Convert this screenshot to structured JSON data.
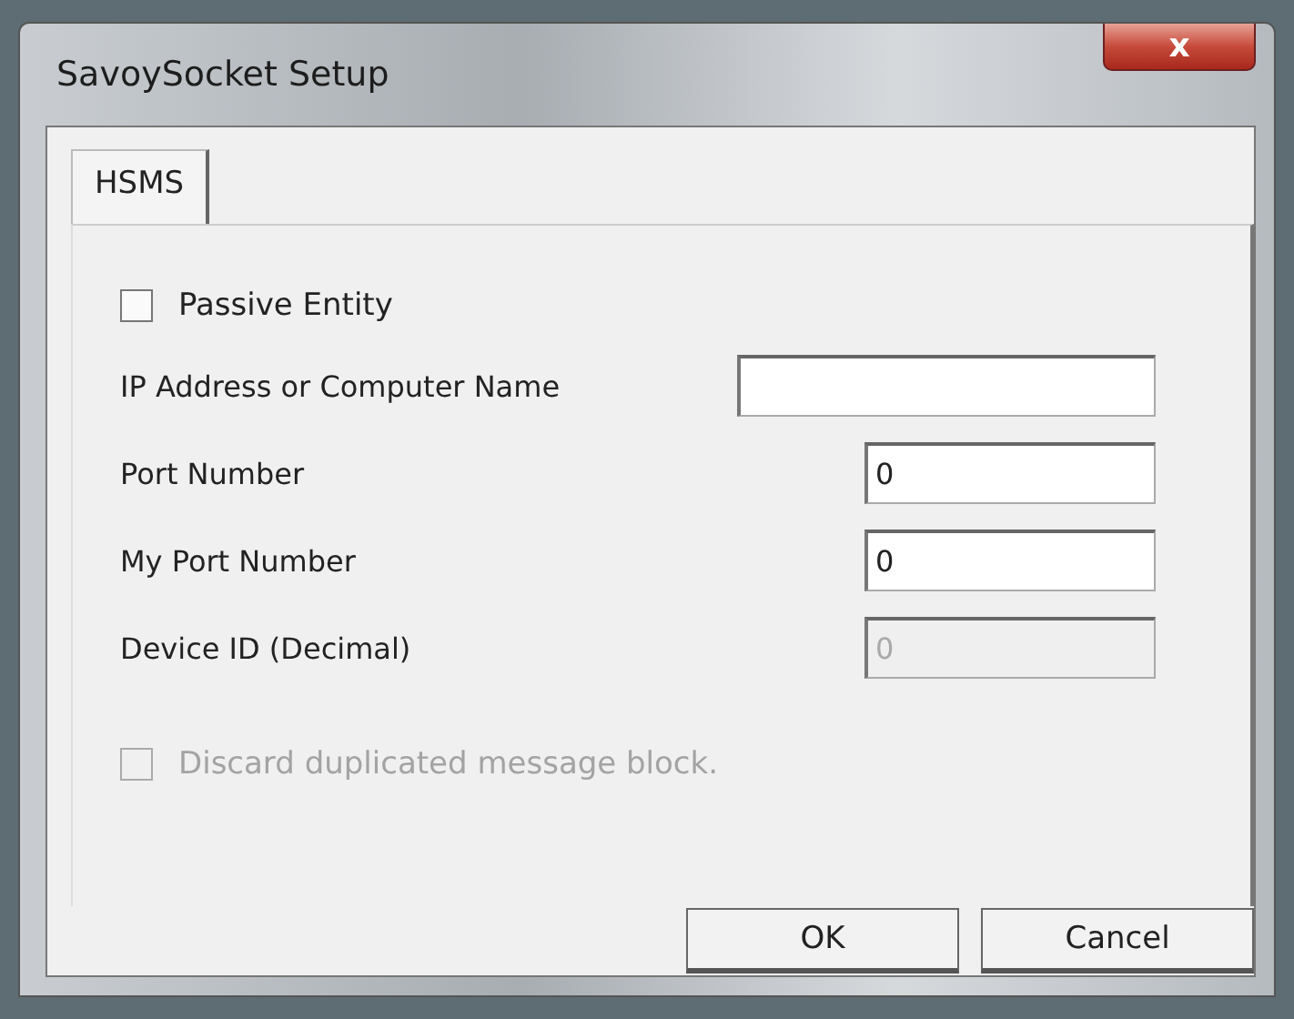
{
  "window": {
    "title": "SavoySocket Setup",
    "close_label": "x"
  },
  "tabs": [
    {
      "label": "HSMS",
      "selected": true
    }
  ],
  "passive_entity": {
    "label": "Passive Entity",
    "checked": false,
    "disabled": false
  },
  "fields": [
    {
      "kind": "text",
      "label": "IP Address or Computer Name",
      "disabled": false
    },
    {
      "kind": "number",
      "label": "Port Number",
      "value": "0",
      "disabled": false
    },
    {
      "kind": "number",
      "label": "My Port Number",
      "value": "0",
      "disabled": false
    },
    {
      "kind": "number",
      "label": "Device ID (Decimal)",
      "value": "0",
      "disabled": true
    }
  ],
  "discard_duplicates": {
    "label": "Discard duplicated message block.",
    "checked": false,
    "disabled": true
  },
  "buttons": [
    "OK",
    "Cancel"
  ]
}
